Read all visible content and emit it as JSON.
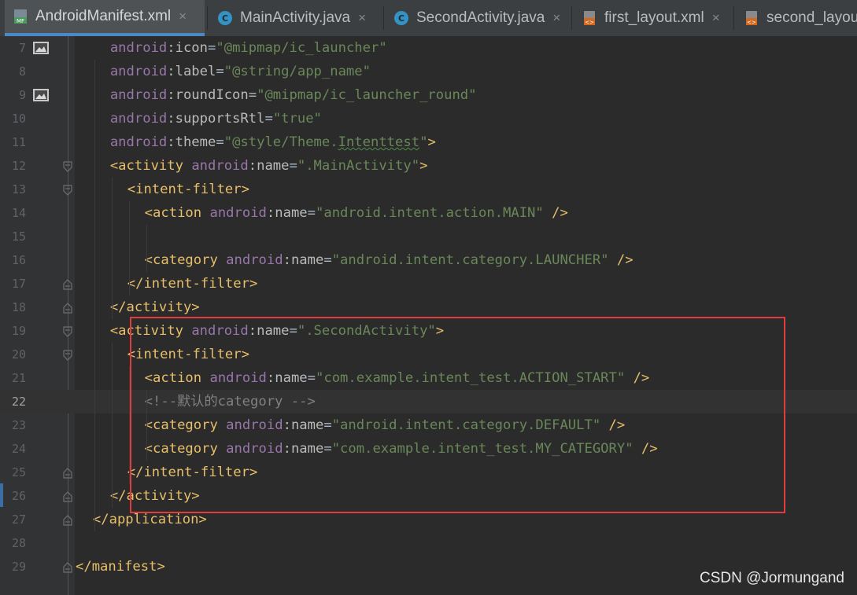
{
  "tabs": [
    {
      "label": "AndroidManifest.xml",
      "icon": "manifest-file-icon",
      "active": true
    },
    {
      "label": "MainActivity.java",
      "icon": "java-class-icon",
      "active": false
    },
    {
      "label": "SecondActivity.java",
      "icon": "java-class-icon",
      "active": false
    },
    {
      "label": "first_layout.xml",
      "icon": "layout-xml-icon",
      "active": false
    },
    {
      "label": "second_layou",
      "icon": "layout-xml-icon",
      "active": false
    }
  ],
  "tab_close_glyph": "×",
  "editor": {
    "current_line": "22",
    "lines": [
      {
        "num": "7",
        "indent": 4,
        "parts": [
          [
            "ns",
            "android"
          ],
          [
            "attr",
            ":icon"
          ],
          [
            "plain",
            "="
          ],
          [
            "str",
            "\"@mipmap/ic_launcher\""
          ]
        ]
      },
      {
        "num": "8",
        "indent": 4,
        "parts": [
          [
            "ns",
            "android"
          ],
          [
            "attr",
            ":label"
          ],
          [
            "plain",
            "="
          ],
          [
            "str",
            "\"@string/app_name\""
          ]
        ]
      },
      {
        "num": "9",
        "indent": 4,
        "parts": [
          [
            "ns",
            "android"
          ],
          [
            "attr",
            ":roundIcon"
          ],
          [
            "plain",
            "="
          ],
          [
            "str",
            "\"@mipmap/ic_launcher_round\""
          ]
        ]
      },
      {
        "num": "10",
        "indent": 4,
        "parts": [
          [
            "ns",
            "android"
          ],
          [
            "attr",
            ":supportsRtl"
          ],
          [
            "plain",
            "="
          ],
          [
            "str",
            "\"true\""
          ]
        ]
      },
      {
        "num": "11",
        "indent": 4,
        "parts": [
          [
            "ns",
            "android"
          ],
          [
            "attr",
            ":theme"
          ],
          [
            "plain",
            "="
          ],
          [
            "str",
            "\"@style/Theme."
          ],
          [
            "squig",
            "Intenttest"
          ],
          [
            "str",
            "\""
          ],
          [
            "tag",
            ">"
          ]
        ]
      },
      {
        "num": "12",
        "indent": 4,
        "parts": [
          [
            "tag",
            "<activity "
          ],
          [
            "ns",
            "android"
          ],
          [
            "attr",
            ":name"
          ],
          [
            "plain",
            "="
          ],
          [
            "str",
            "\".MainActivity\""
          ],
          [
            "tag",
            ">"
          ]
        ]
      },
      {
        "num": "13",
        "indent": 6,
        "parts": [
          [
            "tag",
            "<intent-filter>"
          ]
        ]
      },
      {
        "num": "14",
        "indent": 8,
        "parts": [
          [
            "tag",
            "<action "
          ],
          [
            "ns",
            "android"
          ],
          [
            "attr",
            ":name"
          ],
          [
            "plain",
            "="
          ],
          [
            "str",
            "\"android.intent.action.MAIN\""
          ],
          [
            "tag",
            " />"
          ]
        ]
      },
      {
        "num": "15",
        "indent": 8,
        "parts": []
      },
      {
        "num": "16",
        "indent": 8,
        "parts": [
          [
            "tag",
            "<category "
          ],
          [
            "ns",
            "android"
          ],
          [
            "attr",
            ":name"
          ],
          [
            "plain",
            "="
          ],
          [
            "str",
            "\"android.intent.category.LAUNCHER\""
          ],
          [
            "tag",
            " />"
          ]
        ]
      },
      {
        "num": "17",
        "indent": 6,
        "parts": [
          [
            "tag",
            "</intent-filter>"
          ]
        ]
      },
      {
        "num": "18",
        "indent": 4,
        "parts": [
          [
            "tag",
            "</activity>"
          ]
        ]
      },
      {
        "num": "19",
        "indent": 4,
        "parts": [
          [
            "tag",
            "<activity "
          ],
          [
            "ns",
            "android"
          ],
          [
            "attr",
            ":name"
          ],
          [
            "plain",
            "="
          ],
          [
            "str",
            "\".SecondActivity\""
          ],
          [
            "tag",
            ">"
          ]
        ]
      },
      {
        "num": "20",
        "indent": 6,
        "parts": [
          [
            "tag",
            "<intent-filter>"
          ]
        ]
      },
      {
        "num": "21",
        "indent": 8,
        "parts": [
          [
            "tag",
            "<action "
          ],
          [
            "ns",
            "android"
          ],
          [
            "attr",
            ":name"
          ],
          [
            "plain",
            "="
          ],
          [
            "str",
            "\"com.example.intent_test.ACTION_START\""
          ],
          [
            "tag",
            " />"
          ]
        ]
      },
      {
        "num": "22",
        "indent": 8,
        "parts": [
          [
            "cmt",
            "<!--默认的category -->"
          ]
        ]
      },
      {
        "num": "23",
        "indent": 8,
        "parts": [
          [
            "tag",
            "<category "
          ],
          [
            "ns",
            "android"
          ],
          [
            "attr",
            ":name"
          ],
          [
            "plain",
            "="
          ],
          [
            "str",
            "\"android.intent.category.DEFAULT\""
          ],
          [
            "tag",
            " />"
          ]
        ]
      },
      {
        "num": "24",
        "indent": 8,
        "parts": [
          [
            "tag",
            "<category "
          ],
          [
            "ns",
            "android"
          ],
          [
            "attr",
            ":name"
          ],
          [
            "plain",
            "="
          ],
          [
            "str",
            "\"com.example.intent_test.MY_CATEGORY\""
          ],
          [
            "tag",
            " />"
          ]
        ]
      },
      {
        "num": "25",
        "indent": 6,
        "parts": [
          [
            "tag",
            "</intent-filter>"
          ]
        ]
      },
      {
        "num": "26",
        "indent": 4,
        "parts": [
          [
            "tag",
            "</activity>"
          ]
        ]
      },
      {
        "num": "27",
        "indent": 2,
        "parts": [
          [
            "tag",
            "</application>"
          ]
        ]
      },
      {
        "num": "28",
        "indent": 0,
        "parts": []
      },
      {
        "num": "29",
        "indent": 0,
        "parts": [
          [
            "tag",
            "</manifest>"
          ]
        ]
      }
    ]
  },
  "gutter_image_lines": [
    "7",
    "9"
  ],
  "fold_open_lines": [
    "12",
    "13",
    "19",
    "20"
  ],
  "fold_close_lines": [
    "17",
    "18",
    "25",
    "26",
    "27",
    "29"
  ],
  "watermark": "CSDN @Jormungand",
  "colors": {
    "background": "#2b2b2b",
    "tag": "#e8bf6a",
    "namespace": "#9876aa",
    "string": "#6a8759",
    "comment": "#808080",
    "highlight_box": "#e03c3c"
  }
}
